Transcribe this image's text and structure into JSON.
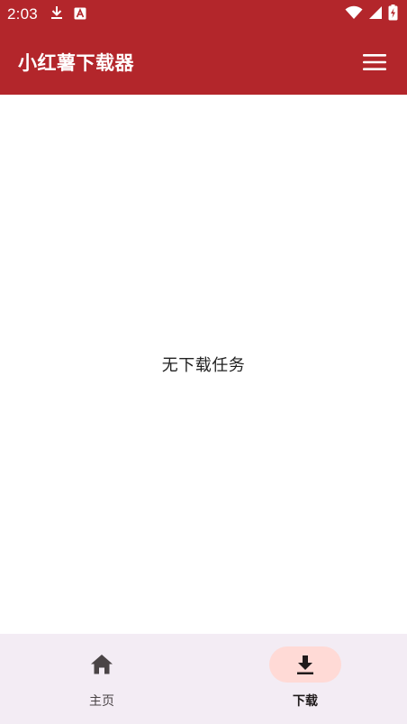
{
  "status_bar": {
    "time": "2:03",
    "notification_icons": [
      "download-icon",
      "app-a-icon"
    ],
    "system_icons": [
      "wifi-icon",
      "signal-icon",
      "battery-charging-icon"
    ]
  },
  "app_bar": {
    "title": "小红薯下载器",
    "menu_icon": "hamburger-menu-icon"
  },
  "content": {
    "empty_message": "无下载任务"
  },
  "bottom_nav": {
    "items": [
      {
        "label": "主页",
        "icon": "home-icon",
        "selected": false
      },
      {
        "label": "下载",
        "icon": "download-icon",
        "selected": true
      }
    ]
  },
  "colors": {
    "primary": "#B3262B",
    "nav_background": "#F3ECF4",
    "nav_indicator": "#FFDAD6"
  }
}
